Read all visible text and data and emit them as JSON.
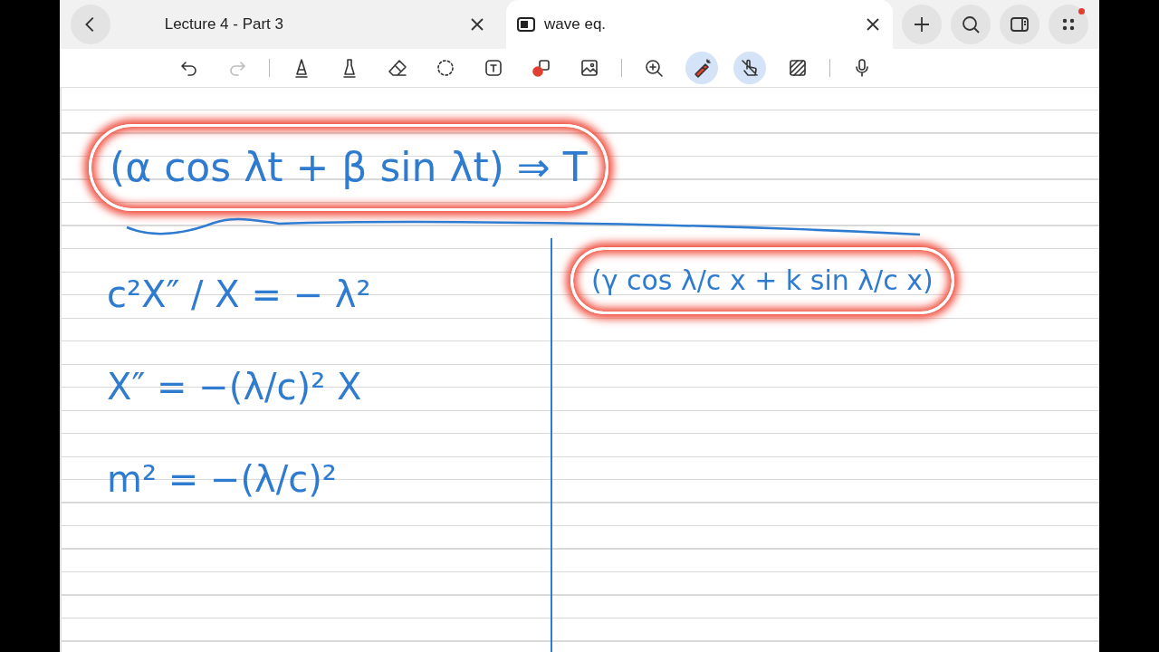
{
  "tabs": [
    {
      "label": "Lecture 4 - Part 3",
      "selected": false
    },
    {
      "label": "wave eq.",
      "selected": true
    }
  ],
  "tab_actions": [
    {
      "kind": "add",
      "notification": false
    },
    {
      "kind": "search",
      "notification": false
    },
    {
      "kind": "sidebar",
      "notification": false
    },
    {
      "kind": "more",
      "notification": true
    }
  ],
  "toolbar": [
    {
      "kind": "undo",
      "selected": false
    },
    {
      "kind": "redo",
      "selected": false
    },
    {
      "kind": "divider"
    },
    {
      "kind": "pen",
      "selected": false
    },
    {
      "kind": "highlighter",
      "selected": false
    },
    {
      "kind": "eraser",
      "selected": false
    },
    {
      "kind": "lasso",
      "selected": false
    },
    {
      "kind": "text",
      "selected": false
    },
    {
      "kind": "shapes",
      "selected": false
    },
    {
      "kind": "image",
      "selected": false
    },
    {
      "kind": "divider"
    },
    {
      "kind": "zoom",
      "selected": false
    },
    {
      "kind": "laser",
      "selected": true
    },
    {
      "kind": "touch",
      "selected": true
    },
    {
      "kind": "pattern",
      "selected": false
    },
    {
      "kind": "divider"
    },
    {
      "kind": "mic",
      "selected": false
    }
  ],
  "note": {
    "top": {
      "text": "(α cos λt + β sin λt) ⇒ T",
      "highlighted": true
    },
    "left": [
      {
        "text": "c²X″ / X  =  − λ²",
        "highlighted": false
      },
      {
        "text": "X″  =  −(λ/c)²  X",
        "highlighted": false
      },
      {
        "text": "m²  =  −(λ/c)²",
        "highlighted": false
      }
    ],
    "right": [
      {
        "text": "(γ cos λ/c x + k sin λ/c x)",
        "highlighted": true
      }
    ]
  }
}
